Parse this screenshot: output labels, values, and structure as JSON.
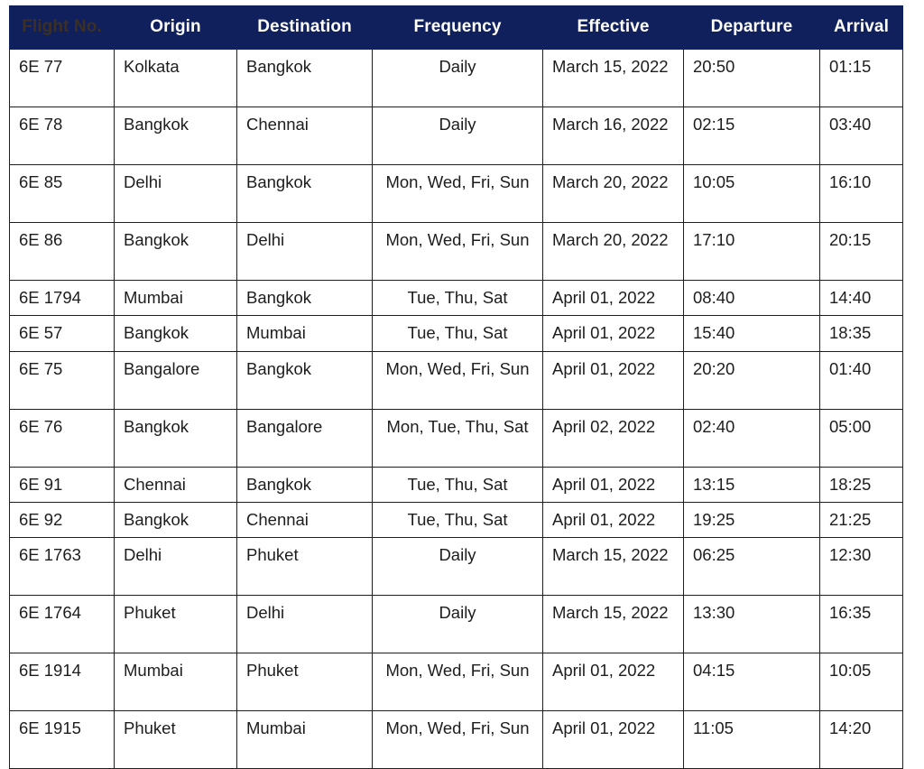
{
  "table": {
    "name": "flight-schedule-table",
    "header_background": "#10205c",
    "header_text_color": "#ffffff",
    "first_header_text_color": "#3c3024",
    "grid_color": "#1f1f1f",
    "columns": [
      {
        "key": "flight_no",
        "label": "Flight No.",
        "align": "left"
      },
      {
        "key": "origin",
        "label": "Origin",
        "align": "left"
      },
      {
        "key": "destination",
        "label": "Destination",
        "align": "left"
      },
      {
        "key": "frequency",
        "label": "Frequency",
        "align": "center"
      },
      {
        "key": "effective",
        "label": "Effective",
        "align": "left"
      },
      {
        "key": "departure",
        "label": "Departure",
        "align": "left"
      },
      {
        "key": "arrival",
        "label": "Arrival",
        "align": "left"
      }
    ],
    "rows": [
      {
        "flight_no": "6E 77",
        "origin": "Kolkata",
        "destination": "Bangkok",
        "frequency": "Daily",
        "effective": "March 15, 2022",
        "departure": "20:50",
        "arrival": "01:15",
        "tall": true
      },
      {
        "flight_no": "6E 78",
        "origin": "Bangkok",
        "destination": "Chennai",
        "frequency": "Daily",
        "effective": "March 16, 2022",
        "departure": "02:15",
        "arrival": "03:40",
        "tall": true
      },
      {
        "flight_no": "6E 85",
        "origin": "Delhi",
        "destination": "Bangkok",
        "frequency": "Mon, Wed, Fri, Sun",
        "effective": "March 20, 2022",
        "departure": "10:05",
        "arrival": "16:10",
        "tall": true
      },
      {
        "flight_no": "6E 86",
        "origin": "Bangkok",
        "destination": "Delhi",
        "frequency": "Mon, Wed, Fri, Sun",
        "effective": "March 20, 2022",
        "departure": "17:10",
        "arrival": "20:15",
        "tall": true
      },
      {
        "flight_no": "6E 1794",
        "origin": "Mumbai",
        "destination": "Bangkok",
        "frequency": "Tue, Thu, Sat",
        "effective": "April 01, 2022",
        "departure": "08:40",
        "arrival": "14:40",
        "tall": false
      },
      {
        "flight_no": "6E 57",
        "origin": "Bangkok",
        "destination": "Mumbai",
        "frequency": "Tue, Thu, Sat",
        "effective": "April 01, 2022",
        "departure": "15:40",
        "arrival": "18:35",
        "tall": false
      },
      {
        "flight_no": "6E 75",
        "origin": "Bangalore",
        "destination": "Bangkok",
        "frequency": "Mon, Wed, Fri, Sun",
        "effective": "April 01, 2022",
        "departure": "20:20",
        "arrival": "01:40",
        "tall": true
      },
      {
        "flight_no": "6E 76",
        "origin": "Bangkok",
        "destination": "Bangalore",
        "frequency": "Mon, Tue, Thu, Sat",
        "effective": "April 02, 2022",
        "departure": "02:40",
        "arrival": "05:00",
        "tall": true
      },
      {
        "flight_no": "6E 91",
        "origin": "Chennai",
        "destination": "Bangkok",
        "frequency": "Tue, Thu, Sat",
        "effective": "April 01, 2022",
        "departure": "13:15",
        "arrival": "18:25",
        "tall": false
      },
      {
        "flight_no": "6E 92",
        "origin": "Bangkok",
        "destination": "Chennai",
        "frequency": "Tue, Thu, Sat",
        "effective": "April 01, 2022",
        "departure": "19:25",
        "arrival": "21:25",
        "tall": false
      },
      {
        "flight_no": "6E 1763",
        "origin": "Delhi",
        "destination": "Phuket",
        "frequency": "Daily",
        "effective": "March 15, 2022",
        "departure": "06:25",
        "arrival": "12:30",
        "tall": true
      },
      {
        "flight_no": "6E 1764",
        "origin": "Phuket",
        "destination": "Delhi",
        "frequency": "Daily",
        "effective": "March 15, 2022",
        "departure": "13:30",
        "arrival": "16:35",
        "tall": true
      },
      {
        "flight_no": "6E 1914",
        "origin": "Mumbai",
        "destination": "Phuket",
        "frequency": "Mon, Wed, Fri, Sun",
        "effective": "April 01, 2022",
        "departure": "04:15",
        "arrival": "10:05",
        "tall": true
      },
      {
        "flight_no": "6E 1915",
        "origin": "Phuket",
        "destination": "Mumbai",
        "frequency": "Mon, Wed, Fri, Sun",
        "effective": "April 01, 2022",
        "departure": "11:05",
        "arrival": "14:20",
        "tall": true
      }
    ]
  }
}
